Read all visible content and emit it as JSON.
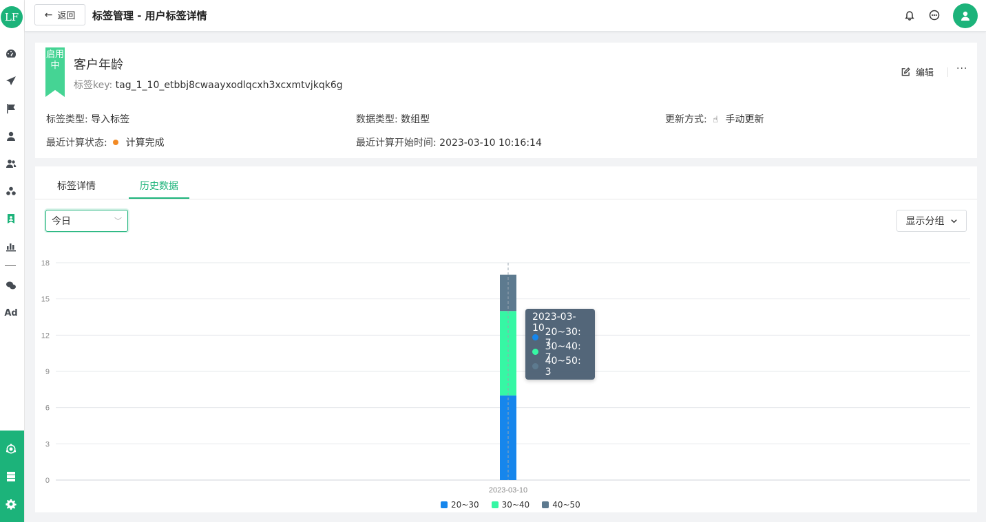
{
  "sidebar": {
    "logo": "LF",
    "icons": [
      "dashboard-icon",
      "send-icon",
      "flag-icon",
      "user-icon",
      "users-icon",
      "cluster-icon",
      "tag-icon",
      "bar-chart-icon",
      "wechat-icon",
      "ad-icon"
    ],
    "ad_label": "Ad",
    "bottom_icons": [
      "org-icon",
      "server-icon",
      "settings-icon"
    ]
  },
  "header": {
    "back_label": "返回",
    "title": "标签管理 - 用户标签详情"
  },
  "tag": {
    "status": "启用中",
    "name": "客户年龄",
    "key_label": "标签key:",
    "key_value": "tag_1_10_etbbj8cwaayxodlqcxh3xcxmtvjkqk6g",
    "edit_label": "编辑",
    "more_label": "···",
    "fields": {
      "tag_type_label": "标签类型:",
      "tag_type_value": "导入标签",
      "data_type_label": "数据类型:",
      "data_type_value": "数组型",
      "update_mode_label": "更新方式:",
      "update_mode_value": "手动更新",
      "calc_status_label": "最近计算状态:",
      "calc_status_value": "计算完成",
      "calc_start_label": "最近计算开始时间:",
      "calc_start_value": "2023-03-10 10:16:14"
    }
  },
  "tabs": [
    {
      "label": "标签详情",
      "active": false
    },
    {
      "label": "历史数据",
      "active": true
    }
  ],
  "filters": {
    "date_range": "今日",
    "group_button": "显示分组"
  },
  "colors": {
    "accent": "#1cb37a",
    "series": [
      "#1686ec",
      "#36f7a4",
      "#5d7a8f"
    ]
  },
  "chart_data": {
    "type": "bar",
    "stacked": true,
    "categories": [
      "2023-03-10"
    ],
    "series": [
      {
        "name": "20~30",
        "values": [
          7
        ]
      },
      {
        "name": "30~40",
        "values": [
          7
        ]
      },
      {
        "name": "40~50",
        "values": [
          3
        ]
      }
    ],
    "ylim": [
      0,
      18
    ],
    "yticks": [
      "0",
      "3",
      "6",
      "9",
      "12",
      "15",
      "18"
    ],
    "grid": true,
    "legend": "bottom-center",
    "tooltip": {
      "title": "2023-03-10",
      "rows": [
        "20~30: 7",
        "30~40: 7",
        "40~50: 3"
      ]
    }
  }
}
